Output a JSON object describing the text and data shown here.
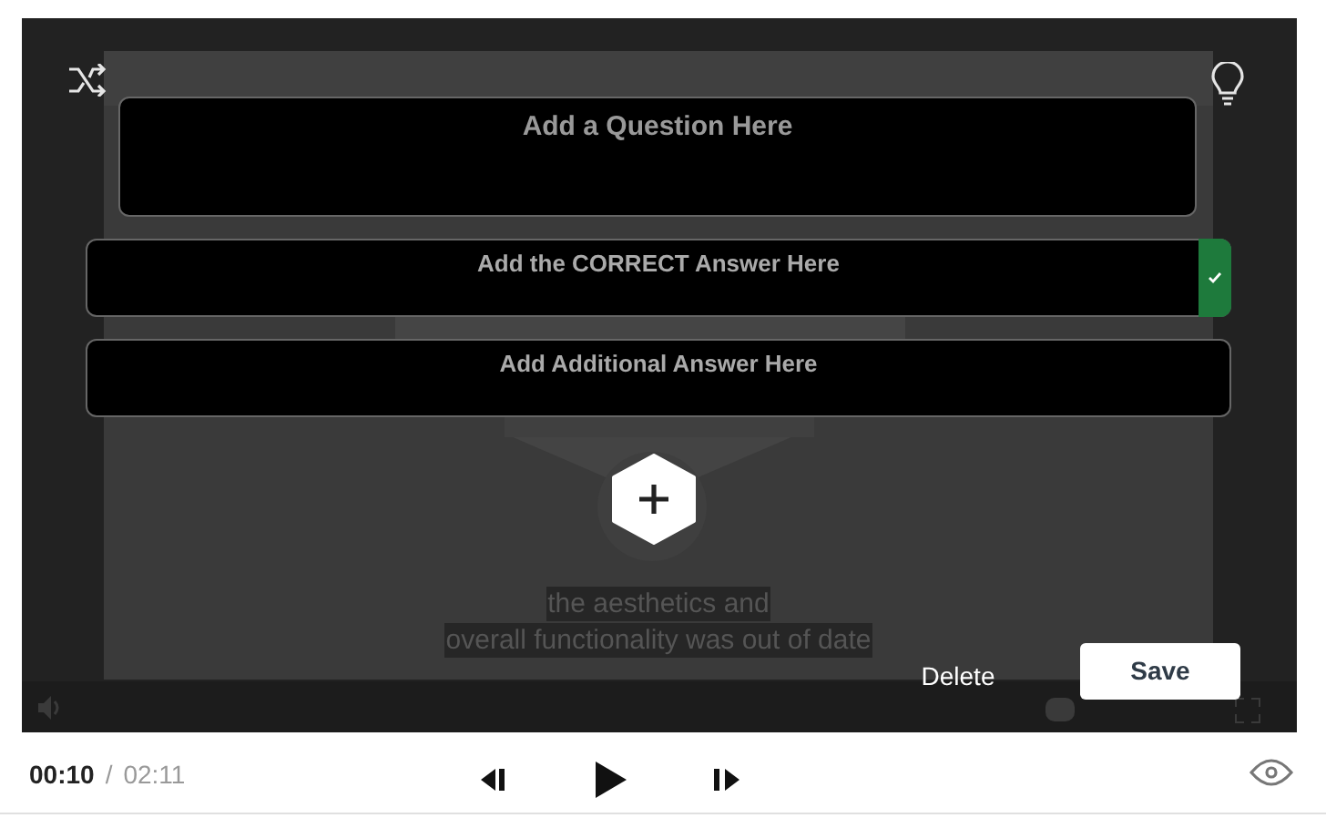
{
  "question": {
    "placeholder": "Add a Question Here"
  },
  "answers": [
    {
      "placeholder": "Add the CORRECT Answer Here",
      "correct": true
    },
    {
      "placeholder": "Add Additional Answer Here",
      "correct": false
    }
  ],
  "captions": [
    "the aesthetics and",
    "overall functionality was out of date"
  ],
  "actions": {
    "delete": "Delete",
    "save": "Save"
  },
  "time": {
    "current": "00:10",
    "separator": "/",
    "total": "02:11"
  }
}
